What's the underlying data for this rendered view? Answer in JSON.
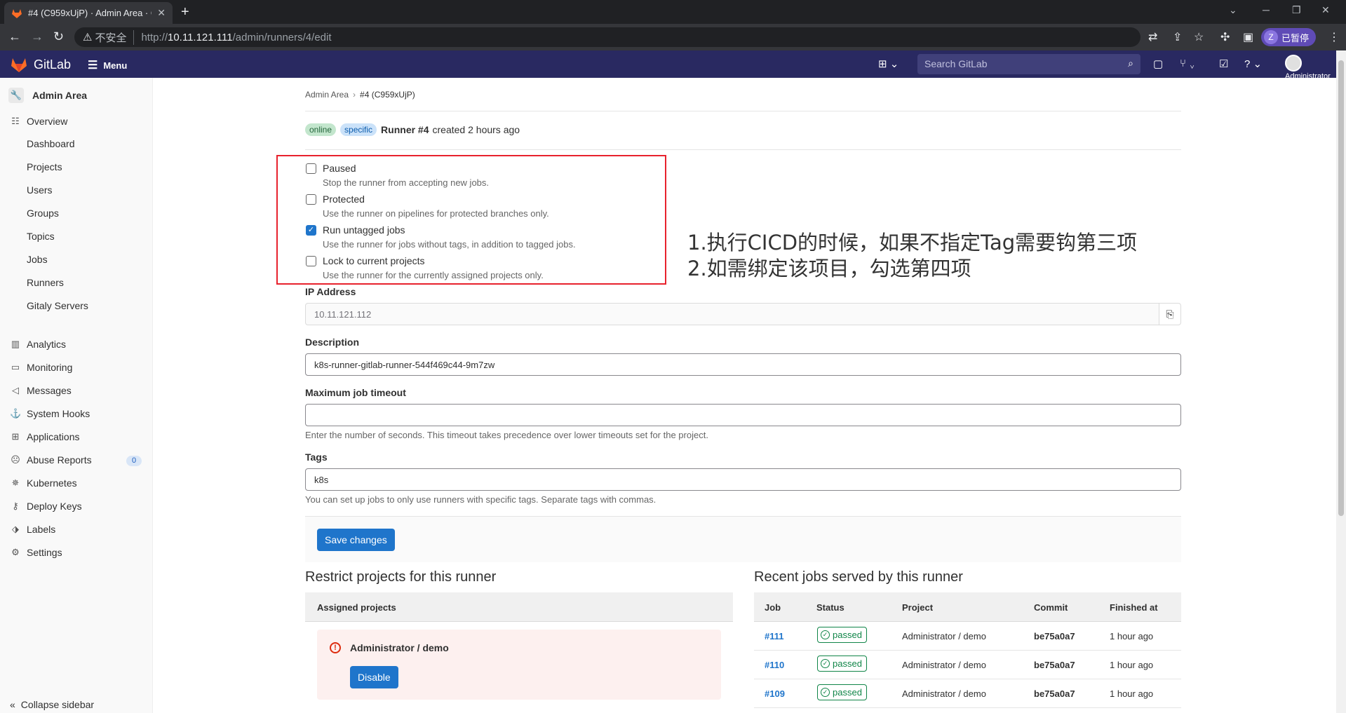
{
  "browser": {
    "tab_title": "#4 (C959xUjP) · Admin Area · G",
    "insecure_label": "不安全",
    "url_scheme": "http://",
    "url_host": "10.11.121.111",
    "url_path": "/admin/runners/4/edit",
    "profile_initial": "Z",
    "profile_label": "已暂停"
  },
  "header": {
    "brand": "GitLab",
    "menu_label": "Menu",
    "search_placeholder": "Search GitLab",
    "user_label": "Administrator"
  },
  "sidebar": {
    "title": "Admin Area",
    "overview": "Overview",
    "overview_items": [
      "Dashboard",
      "Projects",
      "Users",
      "Groups",
      "Topics",
      "Jobs",
      "Runners",
      "Gitaly Servers"
    ],
    "items": [
      {
        "label": "Analytics",
        "icon": "chart-icon"
      },
      {
        "label": "Monitoring",
        "icon": "monitor-icon"
      },
      {
        "label": "Messages",
        "icon": "bullhorn-icon"
      },
      {
        "label": "System Hooks",
        "icon": "hook-icon"
      },
      {
        "label": "Applications",
        "icon": "apps-icon"
      },
      {
        "label": "Abuse Reports",
        "icon": "abuse-icon",
        "badge": "0"
      },
      {
        "label": "Kubernetes",
        "icon": "kubernetes-icon"
      },
      {
        "label": "Deploy Keys",
        "icon": "key-icon"
      },
      {
        "label": "Labels",
        "icon": "label-icon"
      },
      {
        "label": "Settings",
        "icon": "gear-icon"
      }
    ],
    "collapse_label": "Collapse sidebar"
  },
  "breadcrumb": {
    "root": "Admin Area",
    "current": "#4 (C959xUjP)"
  },
  "runner": {
    "status_badge": "online",
    "type_badge": "specific",
    "name": "Runner #4",
    "created": "created 2 hours ago"
  },
  "options": [
    {
      "label": "Paused",
      "help": "Stop the runner from accepting new jobs.",
      "checked": false
    },
    {
      "label": "Protected",
      "help": "Use the runner on pipelines for protected branches only.",
      "checked": false
    },
    {
      "label": "Run untagged jobs",
      "help": "Use the runner for jobs without tags, in addition to tagged jobs.",
      "checked": true
    },
    {
      "label": "Lock to current projects",
      "help": "Use the runner for the currently assigned projects only.",
      "checked": false
    }
  ],
  "annotation": {
    "line1": "1.执行CICD的时候，如果不指定Tag需要钩第三项",
    "line2": "2.如需绑定该项目，勾选第四项"
  },
  "form": {
    "ip_label": "IP Address",
    "ip_value": "10.11.121.112",
    "description_label": "Description",
    "description_value": "k8s-runner-gitlab-runner-544f469c44-9m7zw",
    "timeout_label": "Maximum job timeout",
    "timeout_value": "",
    "timeout_help": "Enter the number of seconds. This timeout takes precedence over lower timeouts set for the project.",
    "tags_label": "Tags",
    "tags_value": "k8s",
    "tags_help": "You can set up jobs to only use runners with specific tags. Separate tags with commas.",
    "save_label": "Save changes"
  },
  "restrict": {
    "title": "Restrict projects for this runner",
    "header": "Assigned projects",
    "project": "Administrator / demo",
    "disable_label": "Disable"
  },
  "jobs": {
    "title": "Recent jobs served by this runner",
    "columns": [
      "Job",
      "Status",
      "Project",
      "Commit",
      "Finished at"
    ],
    "rows": [
      {
        "id": "#111",
        "status": "passed",
        "project": "Administrator / demo",
        "commit": "be75a0a7",
        "finished": "1 hour ago"
      },
      {
        "id": "#110",
        "status": "passed",
        "project": "Administrator / demo",
        "commit": "be75a0a7",
        "finished": "1 hour ago"
      },
      {
        "id": "#109",
        "status": "passed",
        "project": "Administrator / demo",
        "commit": "be75a0a7",
        "finished": "1 hour ago"
      }
    ]
  },
  "colors": {
    "header_bg": "#292961",
    "primary": "#1f75cb",
    "annotation_box": "#e8222d",
    "passed": "#108548"
  }
}
